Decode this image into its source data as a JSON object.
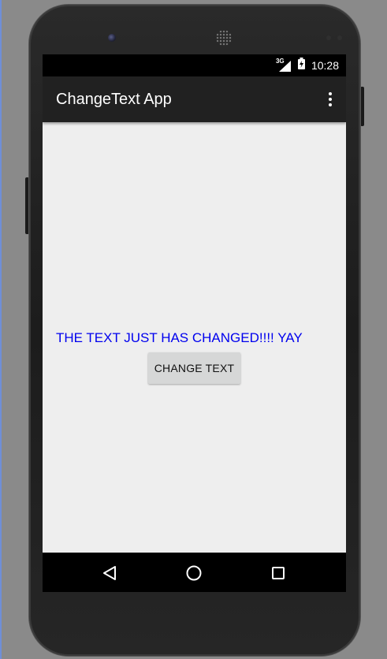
{
  "status_bar": {
    "network_label": "3G",
    "time": "10:28",
    "icons": [
      "signal-icon",
      "battery-charging-icon"
    ]
  },
  "app_bar": {
    "title": "ChangeText App",
    "menu_icon": "overflow-menu-icon"
  },
  "content": {
    "message": "THE TEXT JUST HAS CHANGED!!!! YAY",
    "message_color": "#0000ee",
    "button_label": "CHANGE TEXT"
  },
  "nav_bar": {
    "icons": [
      "back-icon",
      "home-icon",
      "recents-icon"
    ]
  }
}
